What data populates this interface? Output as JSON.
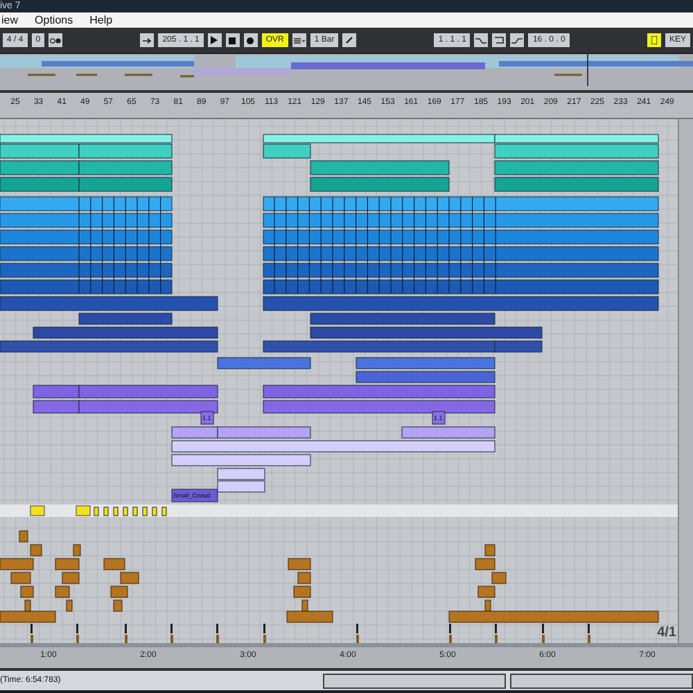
{
  "window": {
    "title": "ive 7"
  },
  "menu": [
    {
      "label": "iew"
    },
    {
      "label": "Options"
    },
    {
      "label": "Help"
    }
  ],
  "control_bar": {
    "time_signature": "4 / 4",
    "groove": "0",
    "position": "205 .  1 .  1",
    "overdub": {
      "label": "OVR",
      "on": true
    },
    "quantization": "1 Bar",
    "loop_start": "1 .  1 .  1",
    "loop_length": "16 .  0 .  0",
    "key_map": "KEY"
  },
  "beat_ruler": [
    "25",
    "33",
    "41",
    "49",
    "57",
    "65",
    "73",
    "81",
    "89",
    "97",
    "105",
    "113",
    "121",
    "129",
    "137",
    "145",
    "153",
    "161",
    "169",
    "177",
    "185",
    "193",
    "201",
    "209",
    "217",
    "225",
    "233",
    "241",
    "249"
  ],
  "clips": [
    {
      "name": "1.1"
    },
    {
      "name": "1.1"
    },
    {
      "name": "Small_Crowd"
    }
  ],
  "time_ruler": [
    "1:00",
    "2:00",
    "3:00",
    "4:00",
    "5:00",
    "6:00",
    "7:00"
  ],
  "zoom_label": "4/1",
  "status_bar": {
    "text": "(Time: 6:54:783)"
  }
}
